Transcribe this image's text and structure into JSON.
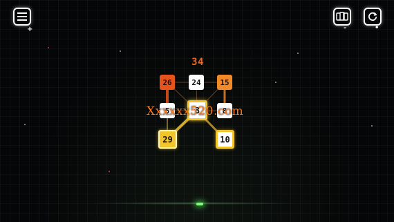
{
  "hud": {
    "menu_icon": "menu-icon",
    "menu_badge": "+",
    "shop_icon": "cards-icon",
    "shop_badge": "-",
    "restart_icon": "restart-icon",
    "restart_badge": "•"
  },
  "score": "34",
  "tiles": {
    "t26": "26",
    "t24": "24",
    "t15": "15",
    "t5": "5",
    "center": "3",
    "t8": "8",
    "t29": "29",
    "t10": "10"
  },
  "colors": {
    "orange_red": "#e8531c",
    "orange": "#f28a2a",
    "yellow": "#f2c52d",
    "white": "#ffffff",
    "score": "#f0651e"
  },
  "watermark": "Xxxxxx520.com"
}
